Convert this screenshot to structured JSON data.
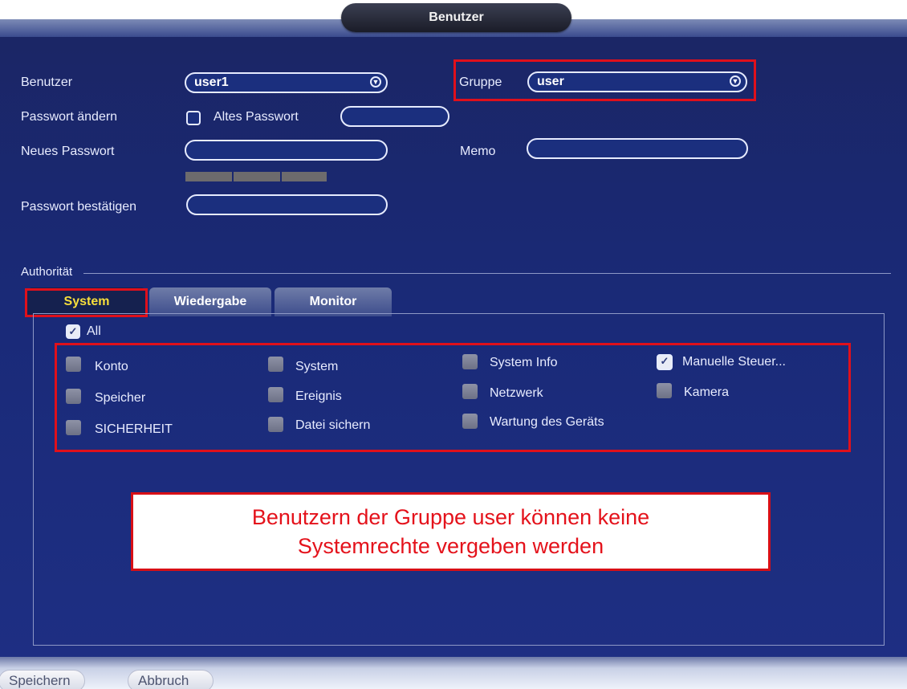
{
  "window": {
    "title": "Benutzer"
  },
  "form": {
    "user_label": "Benutzer",
    "user_value": "user1",
    "group_label": "Gruppe",
    "group_value": "user",
    "change_password_label": "Passwort ändern",
    "old_password_label": "Altes Passwort",
    "new_password_label": "Neues Passwort",
    "memo_label": "Memo",
    "confirm_password_label": "Passwort bestätigen"
  },
  "authority": {
    "section_label": "Authorität",
    "tabs": [
      {
        "label": "System",
        "active": true
      },
      {
        "label": "Wiedergabe",
        "active": false
      },
      {
        "label": "Monitor",
        "active": false
      }
    ],
    "all_label": "All",
    "all_checked": true,
    "permissions": [
      {
        "label": "Konto",
        "checked": false,
        "enabled": false
      },
      {
        "label": "System",
        "checked": false,
        "enabled": false
      },
      {
        "label": "System Info",
        "checked": false,
        "enabled": false
      },
      {
        "label": "Manuelle Steuer...",
        "checked": true,
        "enabled": true
      },
      {
        "label": "Speicher",
        "checked": false,
        "enabled": false
      },
      {
        "label": "Ereignis",
        "checked": false,
        "enabled": false
      },
      {
        "label": "Netzwerk",
        "checked": false,
        "enabled": false
      },
      {
        "label": "Kamera",
        "checked": false,
        "enabled": false
      },
      {
        "label": "SICHERHEIT",
        "checked": false,
        "enabled": false
      },
      {
        "label": "Datei sichern",
        "checked": false,
        "enabled": false
      },
      {
        "label": "Wartung des Geräts",
        "checked": false,
        "enabled": false
      }
    ]
  },
  "annotation": {
    "line1": "Benutzern der Gruppe user können keine",
    "line2": "Systemrechte vergeben werden"
  },
  "buttons": {
    "save": "Speichern",
    "cancel": "Abbruch"
  },
  "colors": {
    "highlight": "#e0101b",
    "active_tab_text": "#f7df3b",
    "background": "#1b2a78"
  }
}
